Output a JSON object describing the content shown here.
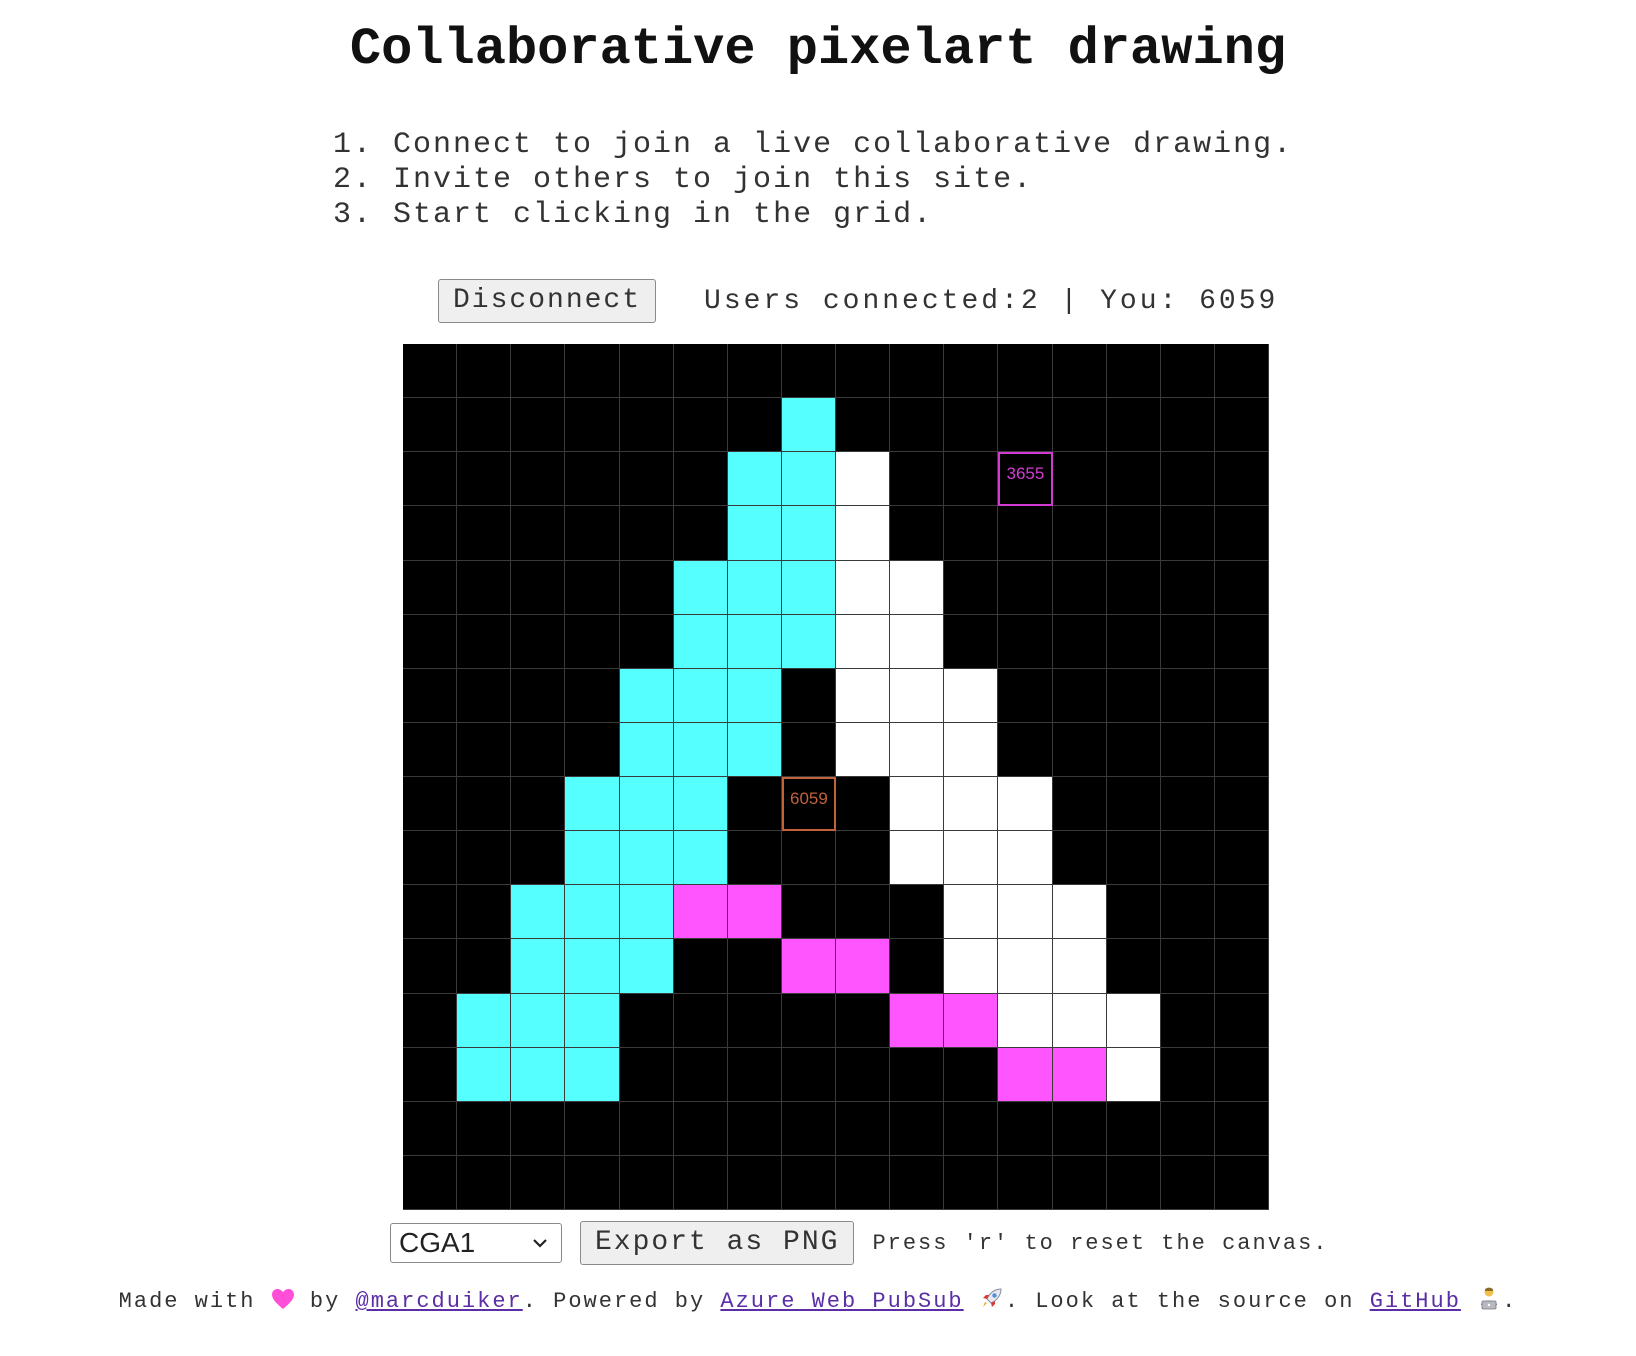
{
  "title": "Collaborative pixelart drawing",
  "instructions": [
    "1. Connect to join a live collaborative drawing.",
    "2. Invite others to join this site.",
    "3. Start clicking in the grid."
  ],
  "toolbar": {
    "disconnect_label": "Disconnect",
    "status_text": "Users connected:2 | You: 6059"
  },
  "canvas": {
    "rows": 16,
    "cols": 16,
    "colors": {
      "0": "#000000",
      "1": "#55ffff",
      "2": "#ff55ff",
      "3": "#ffffff"
    },
    "grid_line_color": "#3a3a3a",
    "pixels": [
      "0000000000000000",
      "0000000100000000",
      "0000001130000000",
      "0000001130000000",
      "0000011133000000",
      "0000011133000000",
      "0000111033300000",
      "0000111033300000",
      "0001110003330000",
      "0001110003330000",
      "0011122000333000",
      "0011100220333000",
      "0111000002233300",
      "0111000000022300",
      "0000000000000000",
      "0000000000000000"
    ],
    "cursors": [
      {
        "user": "3655",
        "row": 2,
        "col": 11,
        "color": "#d23bd2"
      },
      {
        "user": "6059",
        "row": 8,
        "col": 7,
        "color": "#c0623a"
      }
    ]
  },
  "palette": {
    "selected": "CGA1"
  },
  "export_label": "Export as PNG",
  "hint": "Press 'r' to reset the canvas.",
  "footer": {
    "made_with": "Made with",
    "by": "by",
    "author_link": "@marcduiker",
    "powered_by": ". Powered by",
    "service_link": "Azure Web PubSub",
    "look_at": ". Look at the source on",
    "source_link": "GitHub",
    "end": ".",
    "heart_icon": "heart-icon",
    "rocket_icon": "rocket-icon",
    "developer_icon": "technologist-icon"
  }
}
